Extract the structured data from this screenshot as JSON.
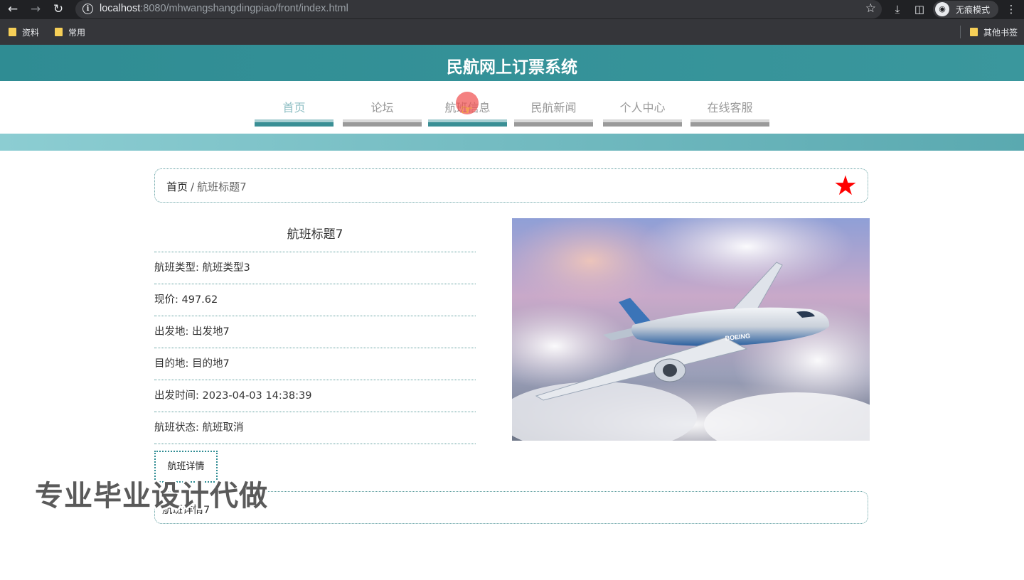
{
  "browser": {
    "url_host": "localhost",
    "url_rest": ":8080/mhwangshangdingpiao/front/index.html",
    "incognito_label": "无痕模式",
    "bookmarks": [
      "资料",
      "常用"
    ],
    "other_bookmarks": "其他书签",
    "icons": [
      "back-arrow-icon",
      "forward-arrow-icon",
      "reload-icon",
      "info-icon",
      "bookmark-star-icon",
      "download-icon",
      "sidebar-icon",
      "incognito-icon",
      "menu-dots-icon",
      "folder-icon"
    ]
  },
  "site": {
    "title": "民航网上订票系统",
    "nav": [
      "首页",
      "论坛",
      "航班信息",
      "民航新闻",
      "个人中心",
      "在线客服"
    ],
    "active_nav": "首页",
    "accent_color": "#2f8c93"
  },
  "breadcrumb": {
    "home": "首页",
    "separator": "/",
    "current": "航班标题7"
  },
  "flight": {
    "title": "航班标题7",
    "type": "航班类型: 航班类型3",
    "price": "现价: 497.62",
    "departure": "出发地: 出发地7",
    "destination": "目的地: 目的地7",
    "time": "出发时间: 2023-04-03 14:38:39",
    "status": "航班状态: 航班取消",
    "detail_button": "航班详情",
    "description": "航班详情7",
    "image_logo": "BOEING"
  },
  "watermark": "专业毕业设计代做"
}
